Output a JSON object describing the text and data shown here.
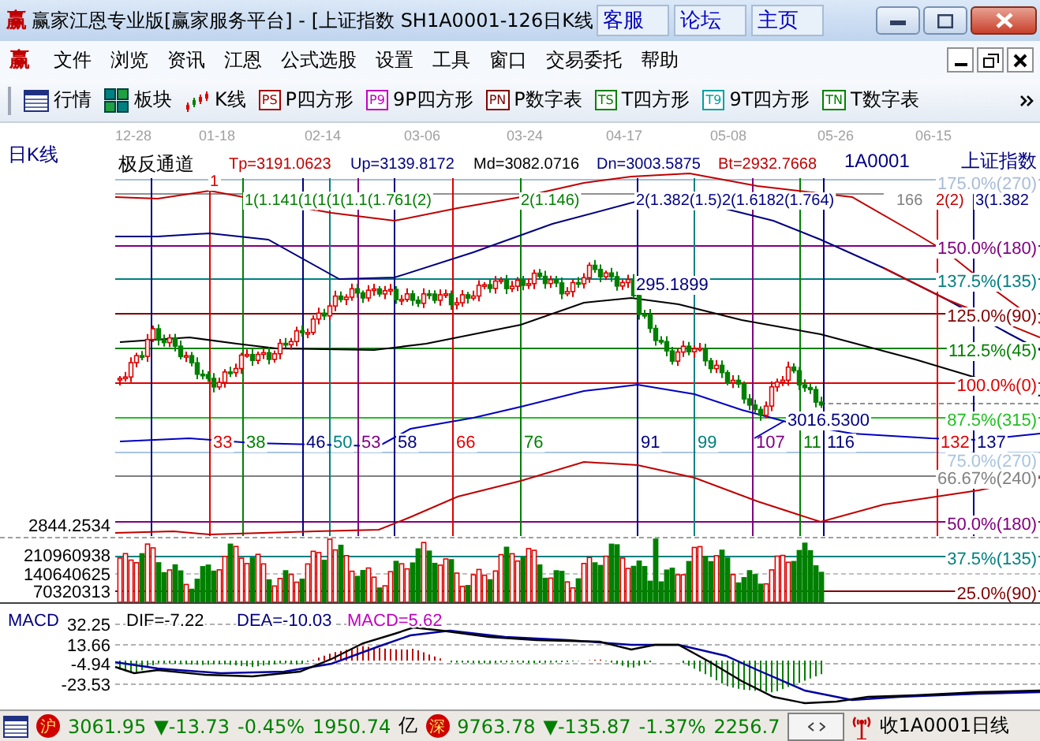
{
  "window": {
    "app_icon": "赢",
    "title": "赢家江恩专业版[赢家服务平台] - [上证指数  SH1A0001-126日K线",
    "links": [
      "客服",
      "论坛",
      "主页"
    ]
  },
  "menu": {
    "app_icon": "赢",
    "items": [
      "文件",
      "浏览",
      "资讯",
      "江恩",
      "公式选股",
      "设置",
      "工具",
      "窗口",
      "交易委托",
      "帮助"
    ]
  },
  "toolbar": [
    {
      "kind": "quotes",
      "label": "行情"
    },
    {
      "kind": "sectors",
      "label": "板块"
    },
    {
      "kind": "kline",
      "label": "K线"
    },
    {
      "kind": "badge",
      "badge": "PS",
      "color": "#a00000",
      "label": "P四方形"
    },
    {
      "kind": "badge",
      "badge": "P9",
      "color": "#c000c0",
      "label": "9P四方形"
    },
    {
      "kind": "badge",
      "badge": "PN",
      "color": "#800000",
      "label": "P数字表"
    },
    {
      "kind": "badge",
      "badge": "TS",
      "color": "#008000",
      "label": "T四方形"
    },
    {
      "kind": "badge",
      "badge": "T9",
      "color": "#00a0a0",
      "label": "9T四方形"
    },
    {
      "kind": "badge",
      "badge": "TN",
      "color": "#008000",
      "label": "T数字表"
    }
  ],
  "chart": {
    "period_label": "日K线",
    "dates": [
      "12-28",
      "01-18",
      "02-14",
      "03-06",
      "03-24",
      "04-17",
      "05-08",
      "05-26",
      "06-15"
    ],
    "indicator": "极反通道",
    "stats": [
      {
        "text": "Tp=3191.0623",
        "color": "#c00000"
      },
      {
        "text": "Up=3139.8172",
        "color": "#000080"
      },
      {
        "text": "Md=3082.0716",
        "color": "#000000"
      },
      {
        "text": "Dn=3003.5875",
        "color": "#000080"
      },
      {
        "text": "Bt=2932.7668",
        "color": "#c00000"
      }
    ],
    "symbol": "1A0001",
    "name": "上证指数",
    "price_axis": [
      "2844.2534"
    ],
    "levels": [
      {
        "label": "175.0%(270)",
        "color": "#a8bcd8"
      },
      {
        "label": "150.0%(180)",
        "color": "#800080"
      },
      {
        "label": "137.5%(135)",
        "color": "#008080"
      },
      {
        "label": "125.0%(90)",
        "color": "#800000"
      },
      {
        "label": "112.5%(45)",
        "color": "#008000"
      },
      {
        "label": "100.0%(0)",
        "color": "#e00000"
      },
      {
        "label": "87.5%(315)",
        "color": "#20c020"
      },
      {
        "label": "75.0%(270)",
        "color": "#a8c4e0"
      },
      {
        "label": "66.67%(240)",
        "color": "#808080"
      },
      {
        "label": "50.0%(180)",
        "color": "#800080"
      }
    ],
    "cycles": [
      {
        "color": "#000080"
      },
      {
        "label": "33",
        "color": "#e00000"
      },
      {
        "label": "38",
        "color": "#008000"
      },
      {
        "label": "46",
        "color": "#000080"
      },
      {
        "label": "50",
        "color": "#008080"
      },
      {
        "label": "53",
        "color": "#800080"
      },
      {
        "label": "58",
        "color": "#000080"
      },
      {
        "label": "66",
        "color": "#e00000"
      },
      {
        "label": "76",
        "color": "#008000"
      },
      {
        "label": "91",
        "color": "#000080"
      },
      {
        "label": "99",
        "color": "#008080"
      },
      {
        "label": "107",
        "color": "#800080"
      },
      {
        "label": "11",
        "color": "#008000"
      },
      {
        "label": "116",
        "color": "#000080"
      },
      {
        "label": "132",
        "color": "#e00000"
      },
      {
        "label": "137",
        "color": "#000080"
      }
    ],
    "top_marks": [
      {
        "text": "1",
        "color": "#e00000"
      },
      {
        "text": "1(1.141(1(1(1(1.1(1.761(2)",
        "color": "#008000"
      },
      {
        "text": "2(1.146)",
        "color": "#008000"
      },
      {
        "text": "2(1.382(1.5)2(1.6182(1.764)",
        "color": "#000080"
      },
      {
        "text": "166",
        "color": "#808080"
      },
      {
        "text": "2(2)",
        "color": "#c00000"
      },
      {
        "text": "3(1.382",
        "color": "#000080"
      }
    ],
    "price_notes": [
      "295.1899",
      "3016.5300"
    ]
  },
  "volume": {
    "ticks": [
      "210960938",
      "140640625",
      "70320313"
    ],
    "levels": [
      {
        "label": "37.5%(135)",
        "color": "#008080"
      },
      {
        "label": "25.0%(90)",
        "color": "#800000"
      }
    ]
  },
  "macd": {
    "title": "MACD",
    "values": [
      {
        "text": "DIF=-7.22",
        "color": "#000000"
      },
      {
        "text": "DEA=-10.03",
        "color": "#000080"
      },
      {
        "text": "MACD=5.62",
        "color": "#c000c0"
      }
    ],
    "ticks": [
      "32.25",
      "13.66",
      "-4.94",
      "-23.53"
    ]
  },
  "status_bar": {
    "markets": [
      {
        "badge": "沪",
        "price": "3061.95",
        "change": "▼-13.73",
        "pct": "-0.45%",
        "amount": "1950.74",
        "unit": "亿"
      },
      {
        "badge": "深",
        "price": "9763.78",
        "change": "▼-135.87",
        "pct": "-1.37%",
        "amount": "2256.7"
      }
    ],
    "message": "收1A0001日线"
  }
}
